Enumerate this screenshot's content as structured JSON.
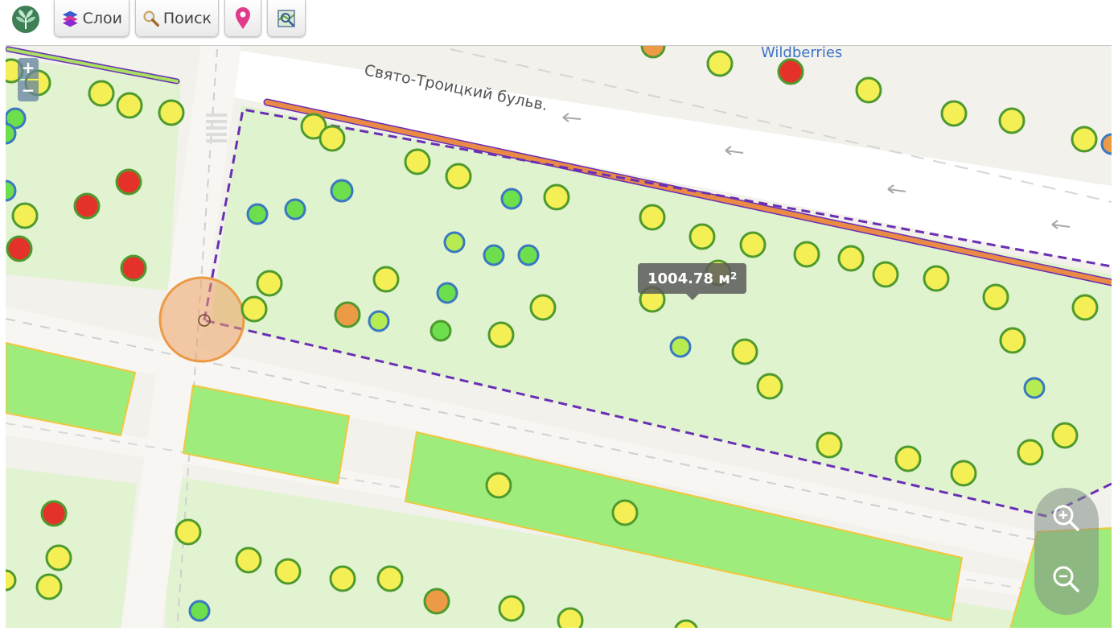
{
  "toolbar": {
    "layers_label": "Слои",
    "search_label": "Поиск"
  },
  "map": {
    "street_label": "Свято-Троицкий бульв.",
    "poi_label": "Wildberries",
    "measure": {
      "value": "1004.78 м",
      "unit_power": "2"
    },
    "zoom_small": {
      "in": "+",
      "out": "−"
    }
  },
  "colors": {
    "tree_yellow": "#f3ef55",
    "tree_red": "#e4322b",
    "tree_orange": "#ec9a45",
    "tree_lightgreen": "#b6ec52",
    "tree_green": "#6ddf4d",
    "tree_outline_green": "#4f9a2e",
    "tree_outline_blue": "#3a78c0",
    "measure_line": "#6a2fb4",
    "road_orange": "#e98a45"
  },
  "icons": {
    "logo": "tree-logo-icon",
    "layers": "layers-icon",
    "search": "magnifier-icon",
    "placemark": "map-pin-icon",
    "map_search": "map-search-icon",
    "zoom_in": "zoom-in-icon",
    "zoom_out": "zoom-out-icon"
  }
}
